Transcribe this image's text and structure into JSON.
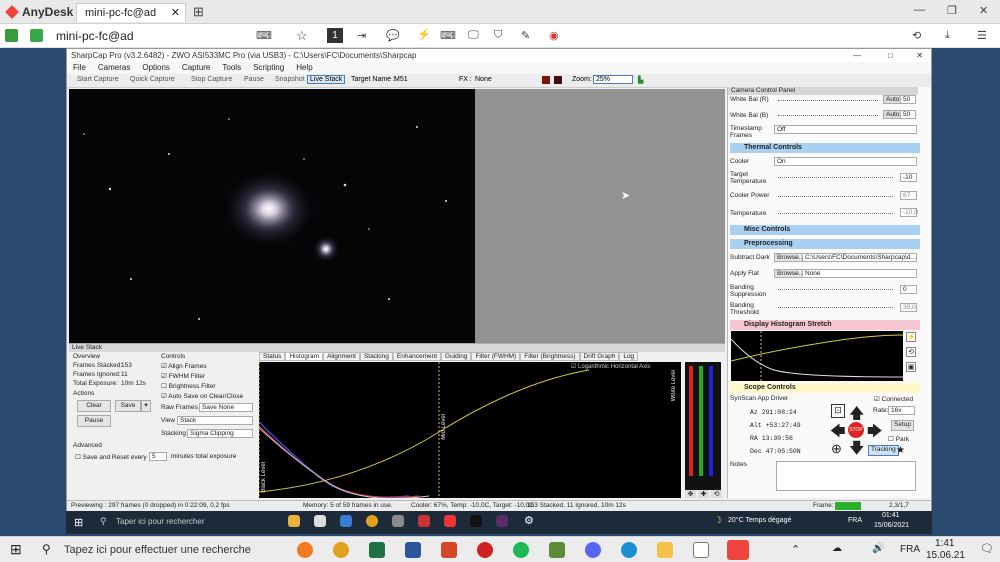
{
  "anydesk": {
    "app_title": "AnyDesk",
    "tab_label": "mini-pc-fc@ad",
    "address": "mini-pc-fc@ad",
    "monitor": "1"
  },
  "sharpcap": {
    "title": "SharpCap Pro (v3.2.6482) - ZWO ASI533MC Pro (via USB3) - C:\\Users\\FC\\Documents\\Sharpcap",
    "menu": [
      "File",
      "Cameras",
      "Options",
      "Capture",
      "Tools",
      "Scripting",
      "Help"
    ],
    "toolbar": {
      "start": "Start Capture",
      "quick": "Quick Capture",
      "stop": "Stop Capture",
      "pause": "Pause",
      "snapshot": "Snapshot",
      "live": "Live Stack",
      "target_label": "Target Name :",
      "target": "M51",
      "fx_label": "FX :",
      "fx": "None",
      "zoom_label": "Zoom:",
      "zoom": "25%"
    },
    "ccp": {
      "title": "Camera Control Panel",
      "wb_r_label": "White Bal (R)",
      "wb_r_auto": "Auto",
      "wb_r": "50",
      "wb_b_label": "White Bal (B)",
      "wb_b_auto": "Auto",
      "wb_b": "50",
      "timestamp_label": "Timestamp Frames",
      "timestamp": "Off",
      "thermal": "Thermal Controls",
      "cooler_label": "Cooler",
      "cooler": "On",
      "target_temp_label": "Target Temperature",
      "target_temp": "-10",
      "cooler_power_label": "Cooler Power",
      "cooler_power": "67",
      "temp_label": "Temperature",
      "temp": "-10,0",
      "misc": "Misc Controls",
      "pre": "Preprocessing",
      "dark_label": "Subtract Dark",
      "browse": "Browse...",
      "dark": "C:\\Users\\FC\\Documents\\Sharpcap\\d...",
      "flat_label": "Apply Flat",
      "flat": "None",
      "banding_label": "Banding Suppression",
      "banding": "0",
      "banding_t_label": "Banding Threshold",
      "banding_t": "35,0",
      "hist_stretch": "Display Histogram Stretch",
      "scope": "Scope Controls",
      "driver": "SynScan App Driver",
      "connected": "Connected",
      "az": "Az  291:08:24",
      "alt": "Alt +53:27:49",
      "ra": "RA  13:30:56",
      "dec": "Dec 47:05:50N",
      "rate_label": "Rate:",
      "rate": "16x",
      "setup": "Setup",
      "park": "Park",
      "tracking": "Tracking",
      "stop": "STOP",
      "notes_label": "Notes"
    },
    "live": {
      "title": "Live Stack",
      "overview": "Overview",
      "stacked_label": "Frames Stacked:",
      "stacked": "153",
      "ignored_label": "Frames Ignored:",
      "ignored": "11",
      "exposure_label": "Total Exposure:",
      "exposure": "10m 12s",
      "actions": "Actions",
      "clear": "Clear",
      "save": "Save",
      "pause": "Pause",
      "controls": "Controls",
      "align": "Align Frames",
      "fwhm": "FWHM Filter",
      "bright": "Brightness Filter",
      "autosave": "Auto Save on Clear/Close",
      "raw_label": "Raw Frames",
      "raw": "Save None",
      "view_label": "View",
      "view": "Stack",
      "stacking_label": "Stacking",
      "stacking": "Sigma Clipping",
      "advanced": "Advanced",
      "save_reset": "Save and Reset every",
      "save_n": "5",
      "save_unit": "minutes total exposure",
      "tabs": [
        "Status",
        "Histogram",
        "Alignment",
        "Stacking",
        "Enhancement",
        "Guiding",
        "Filter (FWHM)",
        "Filter (Brightness)",
        "Drift Graph",
        "Log"
      ],
      "log_axis": "Logarithmic Horizontal Axis",
      "black": "Black Level",
      "mid": "Mid Level",
      "white": "White Level"
    },
    "status": {
      "preview": "Previewing : 297 frames (0 dropped) in 0:22:09, 0,2 fps",
      "memory": "Memory: 5 of 59 frames in use.",
      "cooler": "Cooler: 67%, Temp: -10,0C, Target: -10,0C",
      "stack": "153 Stacked, 11 Ignored, 10m 12s",
      "frame": "Frame:",
      "coords": "2,3/1,7"
    }
  },
  "remote_taskbar": {
    "search": "Taper ici pour rechercher",
    "weather": "20°C  Temps dégagé",
    "lang": "FRA",
    "time": "01:41",
    "date": "15/06/2021"
  },
  "local_taskbar": {
    "search": "Tapez ici pour effectuer une recherche",
    "lang": "FRA",
    "time": "1:41",
    "date": "15.06.21"
  }
}
